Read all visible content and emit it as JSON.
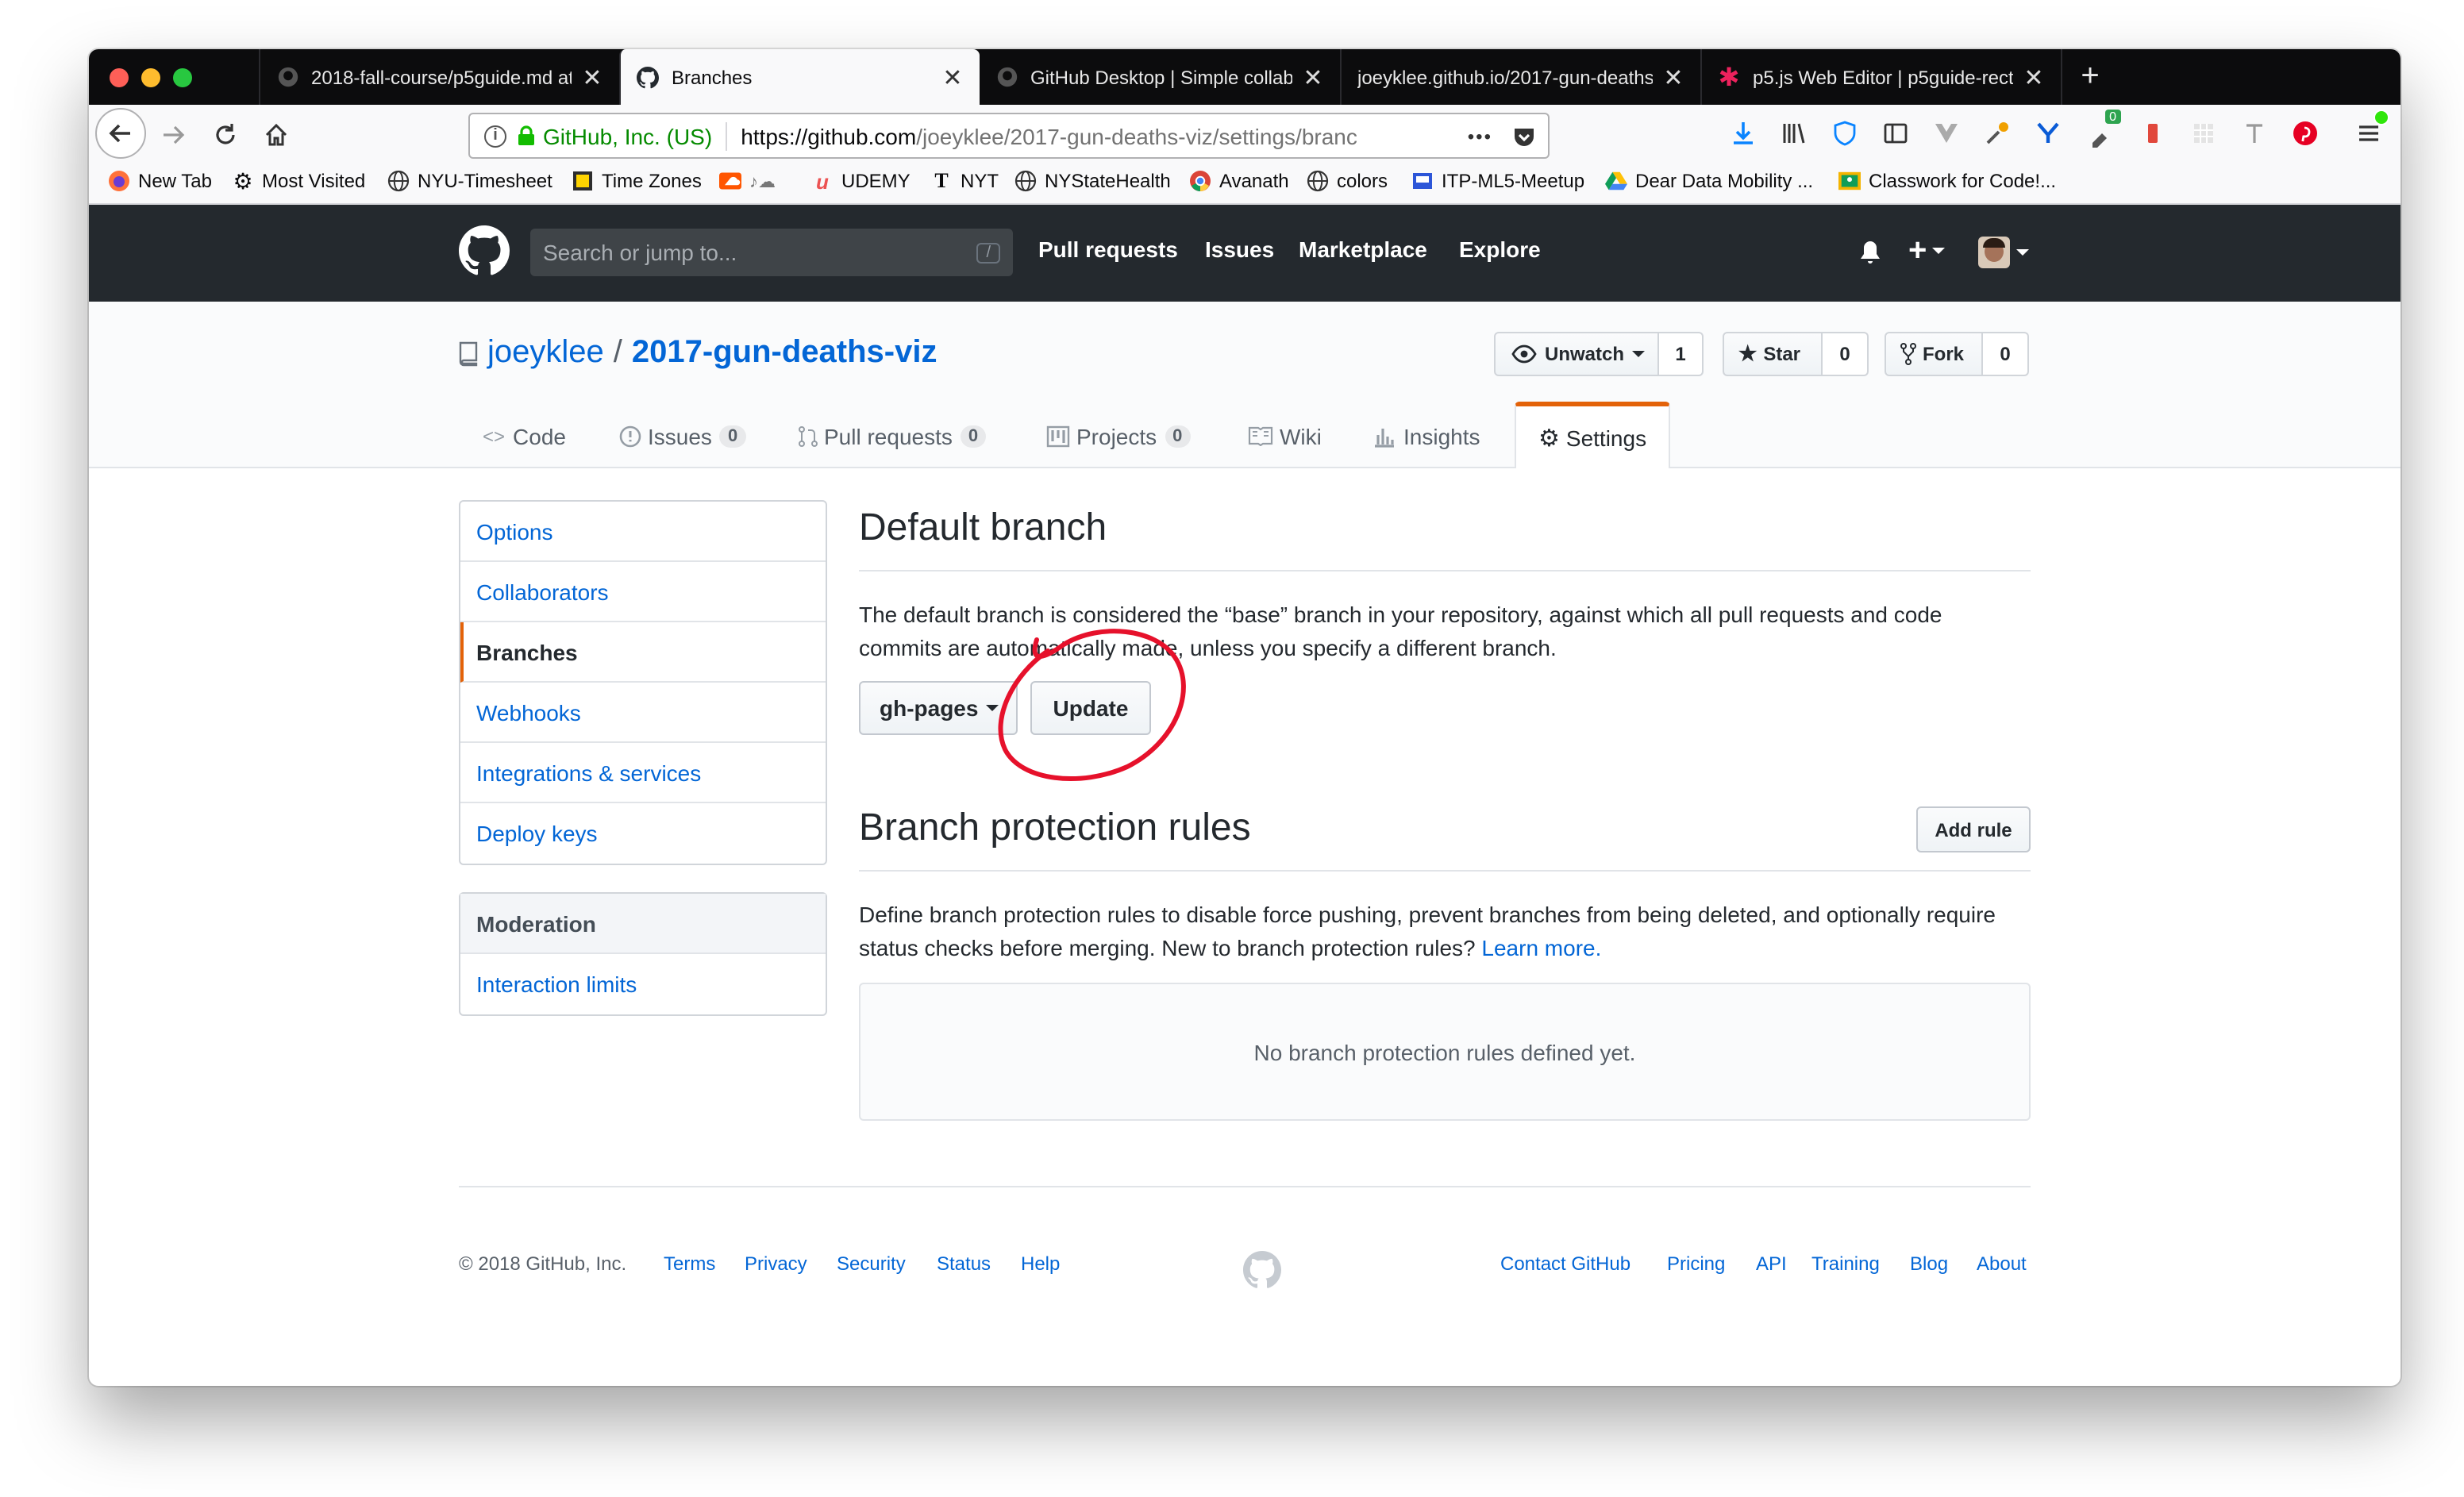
{
  "browser": {
    "tabs": [
      {
        "title": "2018-fall-course/p5guide.md at",
        "icon": "github-icon"
      },
      {
        "title": "Branches",
        "icon": "github-icon",
        "active": true
      },
      {
        "title": "GitHub Desktop | Simple collab",
        "icon": "github-icon"
      },
      {
        "title": "joeyklee.github.io/2017-gun-deaths",
        "icon": "none"
      },
      {
        "title": "p5.js Web Editor | p5guide-rect",
        "icon": "p5-star-icon"
      }
    ],
    "new_tab_symbol": "+",
    "url": {
      "identity": "GitHub, Inc. (US)",
      "prefix": "https://github.com",
      "path": "/joeyklee/2017-gun-deaths-viz/settings/branc",
      "more": "•••"
    },
    "toolbar_badge": "0",
    "bookmarks": [
      {
        "label": "New Tab",
        "icon": "firefox-icon"
      },
      {
        "label": "Most Visited",
        "icon": "gear-icon"
      },
      {
        "label": "NYU-Timesheet",
        "icon": "globe-icon"
      },
      {
        "label": "Time Zones",
        "icon": "clock-icon"
      },
      {
        "label": "",
        "icon": "soundcloud-icon"
      },
      {
        "label": "UDEMY",
        "icon": "udemy-icon"
      },
      {
        "label": "NYT",
        "icon": "nyt-icon"
      },
      {
        "label": "NYStateHealth",
        "icon": "globe-icon"
      },
      {
        "label": "Avanath",
        "icon": "chrome-icon"
      },
      {
        "label": "colors",
        "icon": "globe-icon"
      },
      {
        "label": "ITP-ML5-Meetup",
        "icon": "meetup-icon"
      },
      {
        "label": "Dear Data Mobility ...",
        "icon": "drive-icon"
      },
      {
        "label": "Classwork for Code!...",
        "icon": "classroom-icon"
      }
    ]
  },
  "github": {
    "search_placeholder": "Search or jump to...",
    "search_shortcut": "/",
    "nav": [
      "Pull requests",
      "Issues",
      "Marketplace",
      "Explore"
    ],
    "repo": {
      "owner": "joeyklee",
      "separator": "/",
      "name": "2017-gun-deaths-viz"
    },
    "actions": {
      "watch_label": "Unwatch",
      "watch_count": "1",
      "star_label": "Star",
      "star_count": "0",
      "fork_label": "Fork",
      "fork_count": "0"
    },
    "tabs": [
      {
        "label": "Code"
      },
      {
        "label": "Issues",
        "count": "0"
      },
      {
        "label": "Pull requests",
        "count": "0"
      },
      {
        "label": "Projects",
        "count": "0"
      },
      {
        "label": "Wiki"
      },
      {
        "label": "Insights"
      },
      {
        "label": "Settings",
        "selected": true
      }
    ],
    "sidebar": {
      "items": [
        "Options",
        "Collaborators",
        "Branches",
        "Webhooks",
        "Integrations & services",
        "Deploy keys"
      ],
      "selected": "Branches",
      "moderation_heading": "Moderation",
      "moderation_items": [
        "Interaction limits"
      ]
    },
    "default_branch": {
      "heading": "Default branch",
      "description": "The default branch is considered the “base” branch in your repository, against which all pull requests and code commits are automatically made, unless you specify a different branch.",
      "branch": "gh-pages",
      "update_label": "Update"
    },
    "protection": {
      "heading": "Branch protection rules",
      "add_rule_label": "Add rule",
      "description": "Define branch protection rules to disable force pushing, prevent branches from being deleted, and optionally require status checks before merging. New to branch protection rules?",
      "learn_more": "Learn more.",
      "empty": "No branch protection rules defined yet."
    },
    "footer": {
      "copyright": "© 2018 GitHub, Inc.",
      "left_links": [
        "Terms",
        "Privacy",
        "Security",
        "Status",
        "Help"
      ],
      "right_links": [
        "Contact GitHub",
        "Pricing",
        "API",
        "Training",
        "Blog",
        "About"
      ]
    }
  },
  "colors": {
    "gh_header": "#24292e",
    "link": "#0366d6",
    "selected_accent": "#e36209",
    "annotation_red": "#e6112b"
  }
}
